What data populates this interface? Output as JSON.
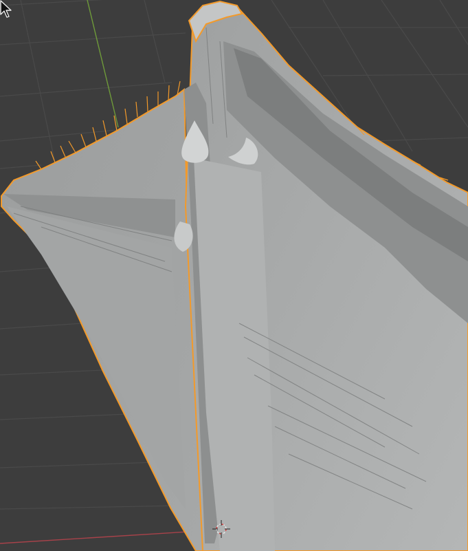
{
  "viewport": {
    "view": "3d-viewport",
    "shading": "solid",
    "background_color": "#3d3d3d",
    "grid_line_color": "#4a4a4a",
    "y_axis_color": "#6e9a3a",
    "x_axis_color": "#a8424a",
    "selection_outline_color": "#f39a2a",
    "mesh_base_color": "#a9abab",
    "object_selected": true,
    "cursor_icon": "mouse-pointer-icon",
    "origin_icon": "3d-cursor-icon"
  }
}
